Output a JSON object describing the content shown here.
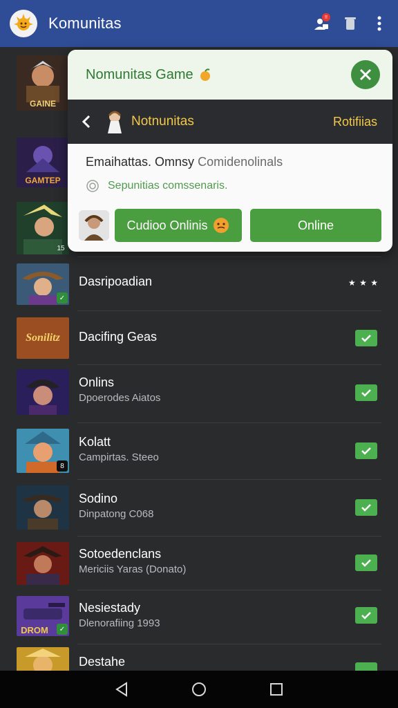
{
  "appbar": {
    "title": "Komunitas",
    "notif_badge": "!!"
  },
  "popup": {
    "title": "Nomunitas Game",
    "nav_title": "Notnunitas",
    "nav_right": "Rotifiias",
    "line1_main": "Emaihattas. Omnsy",
    "line1_muted": "Comidenolinals",
    "line2": "Sepunitias comssenaris.",
    "btn_primary": "Cudioo Onlinis",
    "btn_secondary": "Online"
  },
  "rows": [
    {
      "title": "",
      "subtitle": "",
      "art": "gainer"
    },
    {
      "title": "",
      "subtitle": "",
      "art": "gamer"
    },
    {
      "title": "",
      "subtitle": "",
      "art": "elf"
    },
    {
      "title": "Dasripoadian",
      "subtitle": "",
      "stars": "★ ★ ★",
      "art": "hat"
    },
    {
      "title": "Dacifing Geas",
      "subtitle": "",
      "art": "logo",
      "check": true
    },
    {
      "title": "Onlins",
      "subtitle": "Dpoerodes Aiatos",
      "art": "witch",
      "check": true
    },
    {
      "title": "Kolatt",
      "subtitle": "Campirtas. Steeo",
      "art": "archer",
      "check": true
    },
    {
      "title": "Sodino",
      "subtitle": "Dinpatong C068",
      "art": "cowboy",
      "check": true
    },
    {
      "title": "Sotoedenclans",
      "subtitle": "Mericiis Yaras (Donato)",
      "art": "demon",
      "check": true
    },
    {
      "title": "Nesiestady",
      "subtitle": "Dlenorafiing 1993",
      "art": "tank",
      "check": true
    },
    {
      "title": "Destahe",
      "subtitle": "",
      "art": "gold",
      "check": true
    }
  ],
  "thumb_text": {
    "r0": "GAINE",
    "r1": "GAMTEP",
    "r2": "15",
    "r4": "Sonilitz",
    "r6": "8",
    "r9": "DROM"
  },
  "colors": {
    "appbar": "#2f4d96",
    "accent_green": "#4b9e3f",
    "nav_gold": "#f2c84b",
    "bg": "#2a2b2d"
  }
}
